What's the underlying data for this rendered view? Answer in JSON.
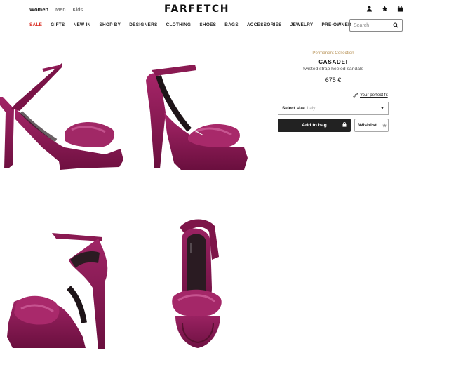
{
  "header": {
    "gender_tabs": [
      "Women",
      "Men",
      "Kids"
    ],
    "logo": "FARFETCH",
    "icons": [
      "account-icon",
      "star-icon",
      "bag-icon"
    ]
  },
  "nav": {
    "items": [
      "SALE",
      "GIFTS",
      "NEW IN",
      "SHOP BY",
      "DESIGNERS",
      "CLOTHING",
      "SHOES",
      "BAGS",
      "ACCESSORIES",
      "JEWELRY",
      "PRE-OWNED"
    ]
  },
  "search": {
    "placeholder": "Search"
  },
  "product": {
    "collection": "Permanent Collection",
    "brand": "CASADEI",
    "description": "twisted strap heeled sandals",
    "price": "675 €",
    "fit_label": "Your perfect fit",
    "size_label": "Select size",
    "size_hint": "Italy",
    "add_to_bag": "Add to bag",
    "wishlist": "Wishlist"
  },
  "colors": {
    "velvet": "#8b1650",
    "velvet_dark": "#5e0c35",
    "sale": "#d9281e",
    "button": "#222222"
  }
}
